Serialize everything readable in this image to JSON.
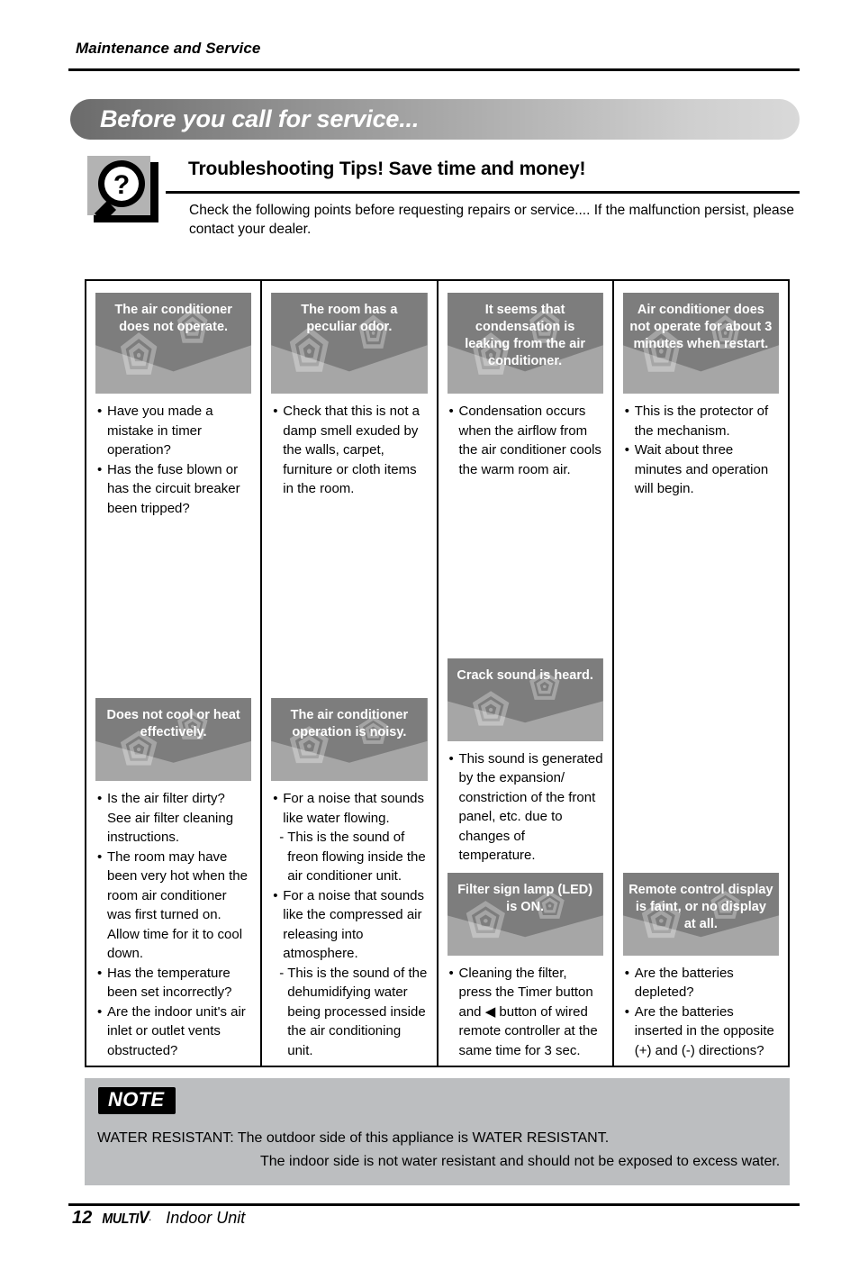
{
  "header": {
    "running_head": "Maintenance and Service",
    "banner_title": "Before you call for service..."
  },
  "tips": {
    "icon": "magnifier-question-icon",
    "title": "Troubleshooting Tips! Save time and money!",
    "description": "Check the following points before requesting repairs or service.... If the malfunction persist, please contact your dealer."
  },
  "table": {
    "row1": [
      {
        "heading": "The air conditioner does not operate.",
        "items": [
          {
            "marker": "•",
            "text": "Have you made a mistake in timer operation?"
          },
          {
            "marker": "•",
            "text": "Has the fuse blown or has the circuit breaker been tripped?"
          }
        ]
      },
      {
        "heading": "The room has a peculiar odor.",
        "items": [
          {
            "marker": "•",
            "text": "Check that this is not a damp smell exuded by the walls, carpet, furniture or cloth items in the room."
          }
        ]
      },
      {
        "heading": "It seems that condensation is leaking from the air conditioner.",
        "items": [
          {
            "marker": "•",
            "text": "Condensation occurs when the airflow from the air conditioner cools the warm room air."
          }
        ]
      },
      {
        "heading": "Air conditioner does not operate for about 3 minutes when restart.",
        "items": [
          {
            "marker": "•",
            "text": "This is the protector of the mechanism."
          },
          {
            "marker": "•",
            "text": "Wait about three minutes and operation will begin."
          }
        ]
      }
    ],
    "row2": [
      {
        "heading": "Does not cool or heat effectively.",
        "items": [
          {
            "marker": "•",
            "text": "Is the air filter dirty? See air filter cleaning instructions."
          },
          {
            "marker": "•",
            "text": "The room may have been very hot when the room air conditioner was first turned on. Allow time for it to cool down."
          },
          {
            "marker": "•",
            "text": "Has the temperature been set incorrectly?"
          },
          {
            "marker": "•",
            "text": "Are the indoor unit's air inlet or outlet vents obstructed?"
          }
        ]
      },
      {
        "heading": "The air conditioner operation is noisy.",
        "items": [
          {
            "marker": "•",
            "text": "For a noise that sounds like water flowing."
          },
          {
            "marker": "-",
            "sub": true,
            "text": "This is the sound of freon flowing inside the air conditioner unit."
          },
          {
            "marker": "•",
            "text": "For a noise that sounds like the compressed air releasing into atmosphere."
          },
          {
            "marker": "-",
            "sub": true,
            "text": "This is the sound of the dehumidifying water being processed inside the air conditioning unit."
          }
        ]
      },
      {
        "heading": "Crack sound is heard.",
        "items": [
          {
            "marker": "•",
            "text": "This sound is generated by the expansion/ constriction of the front panel, etc. due to changes of temperature."
          }
        ],
        "sub_heading": "Filter sign lamp (LED) is ON.",
        "sub_items": [
          {
            "marker": "•",
            "text": "Cleaning the filter, press the Timer button and ◀ button of wired remote controller at the same time for 3 sec."
          }
        ]
      },
      {
        "heading": "Remote control display is faint, or no display at all.",
        "items": [
          {
            "marker": "•",
            "text": "Are the batteries depleted?"
          },
          {
            "marker": "•",
            "text": "Are the batteries inserted in the opposite (+) and (-) directions?"
          }
        ]
      }
    ]
  },
  "note": {
    "badge": "NOTE",
    "line1": "WATER RESISTANT: The outdoor side of this appliance is WATER RESISTANT.",
    "rest": "The indoor side is not water resistant and should not be exposed to excess water."
  },
  "footer": {
    "page_number": "12",
    "logo_text": "MULTI",
    "logo_v": "V",
    "logo_tm": ".",
    "subtitle": "Indoor Unit"
  },
  "colors": {
    "plate_light": "#a6a6a6",
    "plate_dark": "#7d7d7d",
    "note_bg": "#bcbec0",
    "icon_bg": "#b3b3b3"
  }
}
